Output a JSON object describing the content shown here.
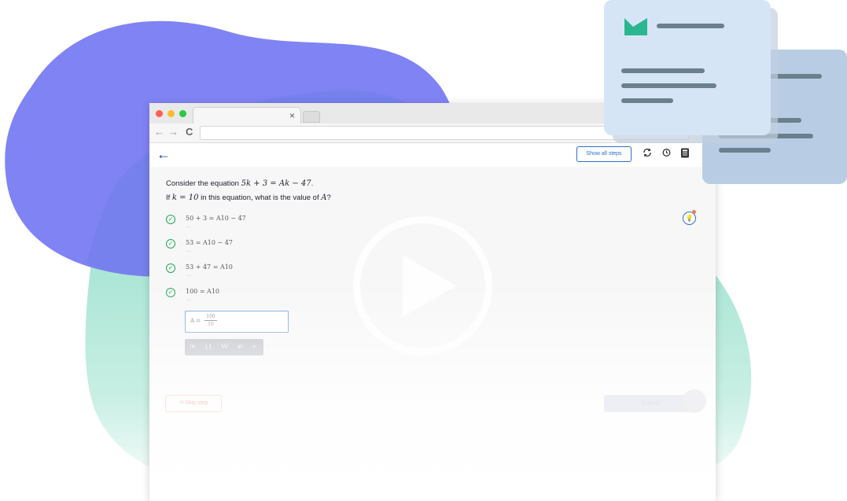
{
  "browser": {
    "tab_close": "×",
    "nav": {
      "back_glyph": "←",
      "forward_glyph": "→",
      "reload_glyph": "C"
    }
  },
  "app": {
    "back_glyph": "←",
    "show_all_steps": "Show all steps",
    "header_icons": [
      "refresh-icon",
      "history-icon",
      "calculator-icon"
    ]
  },
  "question": {
    "line1_prefix": "Consider the equation ",
    "line1_math": "5k + 3 = Ak − 47",
    "line1_suffix": ".",
    "line2_prefix": "If ",
    "line2_math1": "k = 10",
    "line2_mid": " in this equation, what is the value of ",
    "line2_math2": "A",
    "line2_suffix": "?"
  },
  "steps": [
    {
      "math": "50 + 3 = A10 − 47",
      "dots": "..."
    },
    {
      "math": "53 = A10 − 47",
      "dots": "..."
    },
    {
      "math": "53 + 47 = A10",
      "dots": "..."
    },
    {
      "math": "100 = A10",
      "dots": "..."
    }
  ],
  "answer": {
    "var": "A =",
    "numerator": "100",
    "denominator": "10"
  },
  "math_toolbar": [
    "⁝≡",
    "( )",
    "⅟√",
    "xʸ",
    "÷"
  ],
  "footer": {
    "skip": "⟲  Skip step",
    "submit": "Submit"
  },
  "colors": {
    "blob_purple": "#8083f4",
    "blob_teal": "#7fd8c0",
    "card_light": "#d6e5f6",
    "card_dark": "#b8cde4",
    "brand_green": "#2ab78f"
  }
}
